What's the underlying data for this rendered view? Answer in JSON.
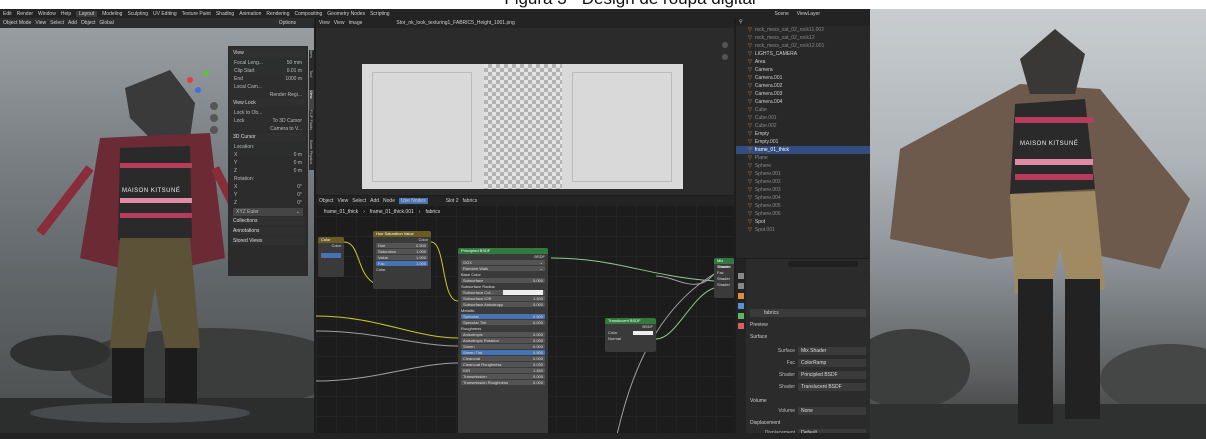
{
  "caption": "Figura 3 - Design de roupa digital",
  "topbar": {
    "menus": [
      "Edit",
      "Render",
      "Window",
      "Help"
    ],
    "workspaces": [
      "Layout",
      "Modeling",
      "Sculpting",
      "UV Editing",
      "Texture Paint",
      "Shading",
      "Animation",
      "Rendering",
      "Compositing",
      "Geometry Nodes",
      "Scripting"
    ],
    "active_workspace": "Layout",
    "scene": "Scene",
    "view_layer": "ViewLayer"
  },
  "viewport3d": {
    "header": [
      "Object Mode",
      "View",
      "Select",
      "Add",
      "Object",
      "Global"
    ],
    "options": "Options",
    "npanel": {
      "view_title": "View",
      "focal_label": "Focal Leng...",
      "focal_value": "50 mm",
      "clip_start_label": "Clip Start",
      "clip_start_value": "0.01 m",
      "end_label": "End",
      "end_value": "1000 m",
      "local_cam": "Local Cam...",
      "render_region": "Render Regi...",
      "view_lock_title": "View Lock",
      "lock_to_obj": "Lock to Ob...",
      "lock_label": "Lock",
      "to_3d_cursor": "To 3D Cursor",
      "camera_to_view": "Camera to V...",
      "cursor_title": "3D Cursor",
      "location": "Location:",
      "rotation": "Rotation:",
      "coord_rows": [
        {
          "axis": "X",
          "value": "0 m"
        },
        {
          "axis": "Y",
          "value": "0 m"
        },
        {
          "axis": "Z",
          "value": "0 m"
        }
      ],
      "rot_rows": [
        {
          "axis": "X",
          "value": "0°"
        },
        {
          "axis": "Y",
          "value": "0°"
        },
        {
          "axis": "Z",
          "value": "0°"
        }
      ],
      "euler": "XYZ Euler",
      "collections": "Collections",
      "annotations": "Annotations",
      "stored_views": "Stored Views"
    },
    "side_tabs": [
      "Item",
      "Tool",
      "View",
      "FLIP Fluids",
      "Bone Physics"
    ],
    "shirt_text": "MAISON KITSUNÉ"
  },
  "image_editor": {
    "header": [
      "View",
      "View",
      "Image"
    ],
    "filename": "Stor_nk_look_texturing1_FABRIC5_Height_1001.png"
  },
  "node_editor": {
    "header": [
      "Object",
      "View",
      "Select",
      "Add",
      "Node",
      "Use Nodes",
      "Slot 2",
      "fabrics"
    ],
    "breadcrumb": [
      "frame_01_thick",
      "frame_01_thick.001",
      "fabrics"
    ],
    "color_node": {
      "title": "Color",
      "out": "Color"
    },
    "hsv_node": {
      "title": "Hue Saturation Value",
      "out": "Color",
      "rows": [
        {
          "label": "Hue",
          "value": "0.500"
        },
        {
          "label": "Saturation",
          "value": "1.000"
        },
        {
          "label": "Value",
          "value": "1.000"
        },
        {
          "label": "Fac",
          "value": "1.000"
        }
      ],
      "in": "Color"
    },
    "bsdf_node": {
      "title": "Principled BSDF",
      "out": "BSDF",
      "dist": "GGX",
      "sss": "Random Walk",
      "rows": [
        {
          "label": "Base Color",
          "value": ""
        },
        {
          "label": "Subsurface",
          "value": "0.000"
        },
        {
          "label": "Subsurface Radius",
          "value": ""
        },
        {
          "label": "Subsurface Col...",
          "value": ""
        },
        {
          "label": "Subsurface IOR",
          "value": "1.400"
        },
        {
          "label": "Subsurface Anisotropy",
          "value": "0.000"
        },
        {
          "label": "Metallic",
          "value": ""
        },
        {
          "label": "Specular",
          "value": "0.500"
        },
        {
          "label": "Specular Tint",
          "value": "0.000"
        },
        {
          "label": "Roughness",
          "value": ""
        },
        {
          "label": "Anisotropic",
          "value": "0.000"
        },
        {
          "label": "Anisotropic Rotation",
          "value": "0.000"
        },
        {
          "label": "Sheen",
          "value": "0.000"
        },
        {
          "label": "Sheen Tint",
          "value": "0.500"
        },
        {
          "label": "Clearcoat",
          "value": "0.000"
        },
        {
          "label": "Clearcoat Roughness",
          "value": "0.030"
        },
        {
          "label": "IOR",
          "value": "1.450"
        },
        {
          "label": "Transmission",
          "value": "0.000"
        },
        {
          "label": "Transmission Roughness",
          "value": "0.000"
        }
      ]
    },
    "translucent_node": {
      "title": "Translucent BSDF",
      "out": "BSDF",
      "rows": [
        "Color",
        "Normal"
      ]
    },
    "mix_node": {
      "title": "Mix Shader",
      "out": "Shader",
      "rows": [
        "Fac",
        "Shader",
        "Shader"
      ]
    }
  },
  "outliner": {
    "items": [
      {
        "name": "rock_mess_sat_02_rock11.002",
        "dim": true
      },
      {
        "name": "rock_mess_sat_02_rock12",
        "dim": true
      },
      {
        "name": "rock_mess_sat_02_rock12.001",
        "dim": true
      },
      {
        "name": "LIGHTS_CAMERA",
        "dim": false
      },
      {
        "name": "Area",
        "dim": false
      },
      {
        "name": "Camera",
        "dim": false
      },
      {
        "name": "Camera.001",
        "dim": false
      },
      {
        "name": "Camera.002",
        "dim": false
      },
      {
        "name": "Camera.003",
        "dim": false
      },
      {
        "name": "Camera.004",
        "dim": false
      },
      {
        "name": "Cube",
        "dim": true
      },
      {
        "name": "Cube.001",
        "dim": true
      },
      {
        "name": "Cube.002",
        "dim": true
      },
      {
        "name": "Empty",
        "dim": false
      },
      {
        "name": "Empty.001",
        "dim": false
      },
      {
        "name": "frame_01_thick",
        "dim": false,
        "sel": true
      },
      {
        "name": "Plane",
        "dim": true
      },
      {
        "name": "Sphere",
        "dim": true
      },
      {
        "name": "Sphere.001",
        "dim": true
      },
      {
        "name": "Sphere.002",
        "dim": true
      },
      {
        "name": "Sphere.003",
        "dim": true
      },
      {
        "name": "Sphere.004",
        "dim": true
      },
      {
        "name": "Sphere.005",
        "dim": true
      },
      {
        "name": "Sphere.006",
        "dim": true
      },
      {
        "name": "Spot",
        "dim": false
      },
      {
        "name": "Spot.001",
        "dim": true
      }
    ]
  },
  "properties": {
    "material": "fabrics",
    "preview": "Preview",
    "surface": "Surface",
    "rows": [
      {
        "label": "Surface",
        "value": "Mix Shader"
      },
      {
        "label": "Fac",
        "value": "ColorRamp"
      },
      {
        "label": "Shader",
        "value": "Principled BSDF"
      },
      {
        "label": "Shader",
        "value": "Translucent BSDF"
      }
    ],
    "volume": "Volume",
    "volume_value": "None",
    "displacement": "Displacement",
    "displacement_label": "Displacement",
    "displacement_value": "Default"
  },
  "photo": {
    "shirt_text": "MAISON KITSUNÉ"
  }
}
